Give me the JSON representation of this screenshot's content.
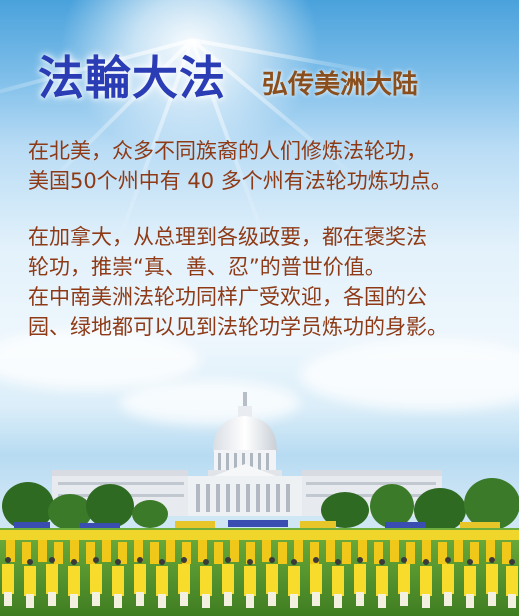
{
  "title": {
    "main": "法輪大法",
    "sub": "弘传美洲大陆"
  },
  "paragraph1": {
    "line1": "在北美，众多不同族裔的人们修炼法轮功，",
    "line2": "美国50个州中有 40 多个州有法轮功炼功点。"
  },
  "paragraph2": {
    "line1": "在加拿大，从总理到各级政要，都在褒奖法",
    "line2": "轮功，推崇“真、善、忍”的普世价值。",
    "line3": "在中南美洲法轮功同样广受欢迎，各国的公",
    "line4": "园、绿地都可以见到法轮功学员炼功的身影。"
  },
  "colors": {
    "title_main": "#2a3db5",
    "title_sub": "#8a4f1c",
    "body_text": "#8e3a16",
    "sky": "#4aa2dc",
    "practitioner_yellow": "#f2d21c"
  },
  "illustration": {
    "subject": "capitol-building-with-practitioners"
  }
}
